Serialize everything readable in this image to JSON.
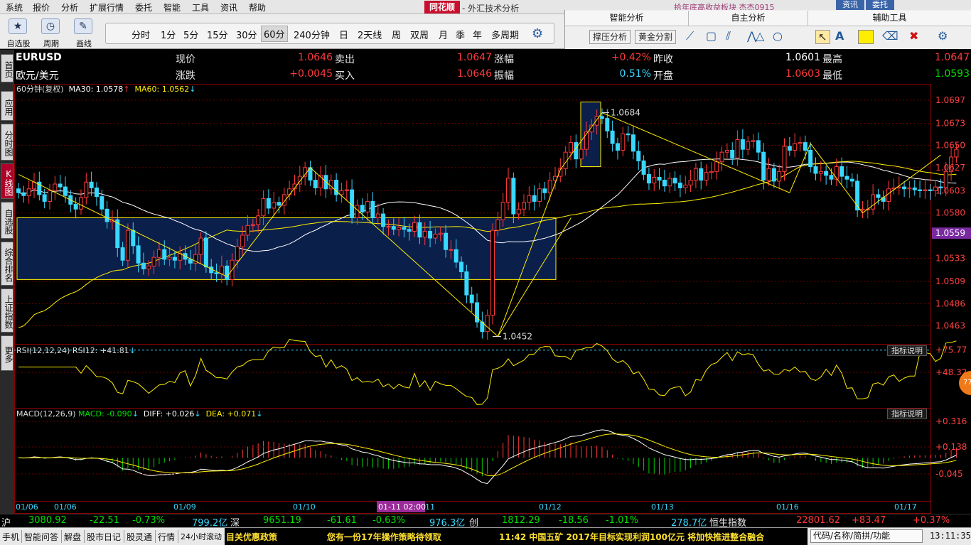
{
  "menu": [
    "系统",
    "报价",
    "分析",
    "扩展行情",
    "委托",
    "智能",
    "工具",
    "资讯",
    "帮助"
  ],
  "app": {
    "logo": "同花顺",
    "title": "- 外汇技术分析",
    "marquee": "拾年底高收益板块  杰杰0915",
    "btn_zixun": "资讯",
    "btn_weituo": "委托"
  },
  "toolbar": {
    "big_tools": [
      {
        "label": "自选股",
        "icon": "star-icon"
      },
      {
        "label": "周期",
        "icon": "clock-icon"
      },
      {
        "label": "画线",
        "icon": "pen-icon"
      }
    ],
    "periods": [
      "分时",
      "1分",
      "5分",
      "15分",
      "30分",
      "60分",
      "240分钟",
      "日",
      "2天线",
      "周",
      "双周",
      "月",
      "季",
      "年",
      "多周期"
    ],
    "active_period": "60分",
    "sections": [
      "智能分析",
      "自主分析",
      "辅助工具"
    ],
    "smart_buttons": [
      "撑压分析",
      "黄金分割"
    ],
    "draw_tools": [
      "line-icon",
      "rect-icon",
      "parallel-icon",
      "wave-icon",
      "triangle-icon",
      "circle-icon"
    ],
    "aux_tools": [
      "cursor-icon",
      "text-icon",
      "color-swatch",
      "eraser-icon",
      "delete-icon",
      "settings-icon"
    ],
    "accent_yellow": "#ffee00"
  },
  "left_tabs": [
    "首页",
    "应用",
    "分时图",
    "K线图",
    "自选股",
    "综合排名",
    "上证指数",
    "更多"
  ],
  "active_left_tab": "K线图",
  "quote": {
    "symbol": "EURUSD",
    "name": "欧元/美元",
    "labels": {
      "xianjia": "现价",
      "zhangdie": "涨跌",
      "maichu": "卖出",
      "mairu": "买入",
      "zhangfu": "涨幅",
      "zhenfu": "振幅",
      "zuoshou": "昨收",
      "kaipan": "开盘",
      "zuigao": "最高",
      "zuidi": "最低"
    },
    "values": {
      "xianjia": "1.0646",
      "zhangdie": "+0.0045",
      "maichu": "1.0647",
      "mairu": "1.0646",
      "zhangfu": "+0.42%",
      "zhenfu": "0.51%",
      "zuoshou": "1.0601",
      "kaipan": "1.0603",
      "zuigao": "1.0647",
      "zuidi": "1.0593"
    }
  },
  "legend": {
    "main": "60分钟(复权)",
    "ma30_label": "MA30: 1.0578",
    "ma60_label": "MA60: 1.0562",
    "rsi": "RSI(12,12,24)  RSI12: +41.81",
    "macd_prefix": "MACD(12,26,9)",
    "macd_val": "MACD: -0.090",
    "diff_val": "DIFF: +0.026",
    "dea_val": "DEA: +0.071",
    "help": "指标说明",
    "bubble": "77"
  },
  "chart_data": {
    "type": "candlestick",
    "price_axis": {
      "ticks": [
        "1.0697",
        "1.0673",
        "1.0650",
        "1.0627",
        "1.0603",
        "1.0580",
        "1.0559",
        "1.0533",
        "1.0509",
        "1.0486",
        "1.0463"
      ],
      "min": 1.0445,
      "max": 1.0705,
      "current": "1.0559"
    },
    "annotations": {
      "high": "1.0684",
      "low": "1.0452",
      "high_value": 1.0684,
      "low_value": 1.0452
    },
    "rsi_axis": [
      "+75.77",
      "+48.32"
    ],
    "macd_axis": [
      "+0.316",
      "+0.138",
      "-0.045"
    ],
    "x_labels": [
      "01/06",
      "01/06",
      "01/09",
      "01/10",
      "01-11 02:00",
      "11",
      "01/12",
      "01/13",
      "01/16",
      "01/17"
    ],
    "crosshair_label": "01-11 02:00",
    "close": [
      1.0601,
      1.0598,
      1.0605,
      1.0612,
      1.0599,
      1.0592,
      1.0603,
      1.061,
      1.0607,
      1.0598,
      1.0589,
      1.0584,
      1.0596,
      1.0612,
      1.0606,
      1.0597,
      1.0584,
      1.0571,
      1.0573,
      1.0544,
      1.0531,
      1.0562,
      1.0546,
      1.0528,
      1.0522,
      1.0525,
      1.0534,
      1.0542,
      1.0532,
      1.0534,
      1.0531,
      1.0538,
      1.0532,
      1.0528,
      1.0537,
      1.0554,
      1.0524,
      1.0518,
      1.0517,
      1.0525,
      1.0511,
      1.0531,
      1.0545,
      1.0557,
      1.0567,
      1.0568,
      1.0577,
      1.0595,
      1.0585,
      1.0591,
      1.0588,
      1.0599,
      1.0605,
      1.061,
      1.0618,
      1.0627,
      1.0614,
      1.0606,
      1.0619,
      1.0605,
      1.0614,
      1.0599,
      1.0603,
      1.0604,
      1.0575,
      1.0588,
      1.0581,
      1.0592,
      1.0575,
      1.0579,
      1.0566,
      1.0566,
      1.0563,
      1.0565,
      1.0563,
      1.0561,
      1.057,
      1.0555,
      1.0561,
      1.0554,
      1.0558,
      1.0559,
      1.0542,
      1.0542,
      1.0529,
      1.0519,
      1.0495,
      1.0487,
      1.0467,
      1.0457,
      1.0474,
      1.0562,
      1.0573,
      1.0591,
      1.0616,
      1.0579,
      1.0584,
      1.0591,
      1.0598,
      1.0592,
      1.0605,
      1.0601,
      1.0614,
      1.0618,
      1.0626,
      1.0643,
      1.0653,
      1.0636,
      1.0646,
      1.0664,
      1.0671,
      1.068,
      1.0678,
      1.0665,
      1.0652,
      1.0645,
      1.0662,
      1.0661,
      1.0644,
      1.0634,
      1.062,
      1.0611,
      1.0617,
      1.0614,
      1.0608,
      1.0616,
      1.0611,
      1.0606,
      1.0609,
      1.0614,
      1.0626,
      1.0614,
      1.0622,
      1.0623,
      1.0633,
      1.0643,
      1.0645,
      1.0637,
      1.0656,
      1.0646,
      1.0654,
      1.0655,
      1.0643,
      1.0614,
      1.0626,
      1.0613,
      1.0623,
      1.0649,
      1.0645,
      1.0652,
      1.0653,
      1.0645,
      1.0628,
      1.0621,
      1.0623,
      1.0619,
      1.0615,
      1.0628,
      1.0618,
      1.0615,
      1.0613,
      1.0583,
      1.0584,
      1.0584,
      1.0599,
      1.0596,
      1.0592,
      1.0605,
      1.0606,
      1.0607,
      1.0605,
      1.0606,
      1.0604,
      1.0603,
      1.0604,
      1.0603,
      1.0607,
      1.0606,
      1.0623,
      1.0638,
      1.0646
    ]
  },
  "index_bar": [
    {
      "name": "沪",
      "price": "3080.92",
      "chg": "-22.51",
      "pct": "-0.73%",
      "amt": "799.2亿"
    },
    {
      "name": "深",
      "price": "9651.19",
      "chg": "-61.61",
      "pct": "-0.63%",
      "amt": "976.3亿"
    },
    {
      "name": "创",
      "price": "1812.29",
      "chg": "-18.56",
      "pct": "-1.01%",
      "amt": "278.7亿"
    },
    {
      "name": "恒生指数",
      "price": "22801.62",
      "chg": "+83.47",
      "pct": "+0.37%",
      "amt": ""
    }
  ],
  "status": {
    "items": [
      "手机",
      "智能问答",
      "解盘",
      "股市日记",
      "股灵通",
      "行情",
      "24小时滚动"
    ],
    "news": [
      "目关优惠政策",
      "您有一份17年操作策略待领取",
      "11:42 中国五矿 2017年目标实现利润100亿元 将加快推进整合融合"
    ],
    "code_box": "代码/名称/简拼/功能",
    "clock": "13:11:35"
  }
}
